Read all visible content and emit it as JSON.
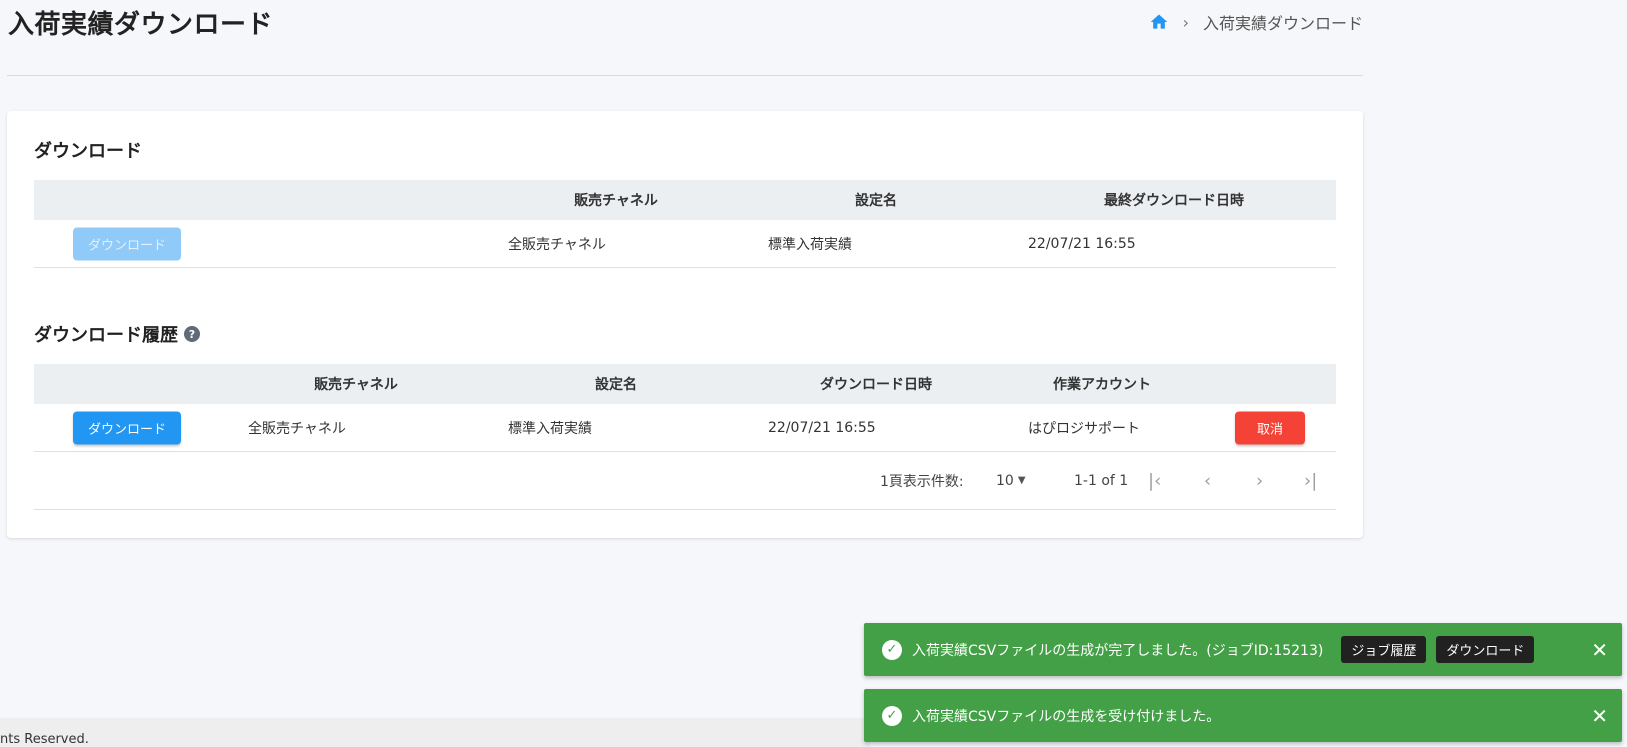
{
  "header": {
    "title": "入荷実績ダウンロード",
    "breadcrumb_current": "入荷実績ダウンロード"
  },
  "download_section": {
    "title": "ダウンロード",
    "columns": [
      "販売チャネル",
      "設定名",
      "最終ダウンロード日時"
    ],
    "row": {
      "button_label": "ダウンロード",
      "channel": "全販売チャネル",
      "setting": "標準入荷実績",
      "last_download": "22/07/21 16:55"
    }
  },
  "history_section": {
    "title": "ダウンロード履歴",
    "help_icon": "?",
    "columns": [
      "販売チャネル",
      "設定名",
      "ダウンロード日時",
      "作業アカウント"
    ],
    "row": {
      "button_label": "ダウンロード",
      "channel": "全販売チャネル",
      "setting": "標準入荷実績",
      "download_time": "22/07/21 16:55",
      "account": "はぴロジサポート",
      "cancel_label": "取消"
    },
    "pager": {
      "per_page_label": "1頁表示件数:",
      "per_page_value": "10",
      "range": "1-1 of 1"
    }
  },
  "footer": {
    "text": "nts Reserved."
  },
  "toasts": [
    {
      "message": "入荷実績CSVファイルの生成が完了しました。(ジョブID:15213)",
      "job_history_label": "ジョブ履歴",
      "download_label": "ダウンロード"
    },
    {
      "message": "入荷実績CSVファイルの生成を受け付けました。"
    }
  ],
  "colors": {
    "primary": "#2196f3",
    "danger": "#f44336",
    "success": "#43a047"
  }
}
